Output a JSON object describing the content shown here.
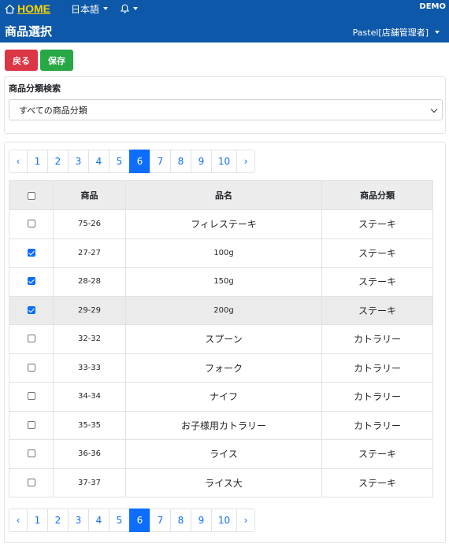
{
  "header": {
    "home_label": "HOME",
    "language": "日本語",
    "env": "DEMO",
    "page_title": "商品選択",
    "user": "Pastel[店舗管理者]",
    "bg_color": "#0d58a8",
    "home_color": "#ffd400"
  },
  "actions": {
    "back_label": "戻る",
    "save_label": "保存"
  },
  "search": {
    "title": "商品分類検索",
    "selected": "すべての商品分類"
  },
  "pagination": {
    "prev": "‹",
    "next": "›",
    "pages": [
      "1",
      "2",
      "3",
      "4",
      "5",
      "6",
      "7",
      "8",
      "9",
      "10"
    ],
    "active_page": "6"
  },
  "table": {
    "columns": [
      "",
      "商品",
      "品名",
      "商品分類"
    ],
    "rows": [
      {
        "code": "75-26",
        "name": "フィレステーキ",
        "category": "ステーキ",
        "checked": false
      },
      {
        "code": "27-27",
        "name": "100g",
        "category": "ステーキ",
        "checked": true
      },
      {
        "code": "28-28",
        "name": "150g",
        "category": "ステーキ",
        "checked": true
      },
      {
        "code": "29-29",
        "name": "200g",
        "category": "ステーキ",
        "checked": true
      },
      {
        "code": "32-32",
        "name": "スプーン",
        "category": "カトラリー",
        "checked": false
      },
      {
        "code": "33-33",
        "name": "フォーク",
        "category": "カトラリー",
        "checked": false
      },
      {
        "code": "34-34",
        "name": "ナイフ",
        "category": "カトラリー",
        "checked": false
      },
      {
        "code": "35-35",
        "name": "お子様用カトラリー",
        "category": "カトラリー",
        "checked": false
      },
      {
        "code": "36-36",
        "name": "ライス",
        "category": "ステーキ",
        "checked": false
      },
      {
        "code": "37-37",
        "name": "ライス大",
        "category": "ステーキ",
        "checked": false
      }
    ]
  }
}
